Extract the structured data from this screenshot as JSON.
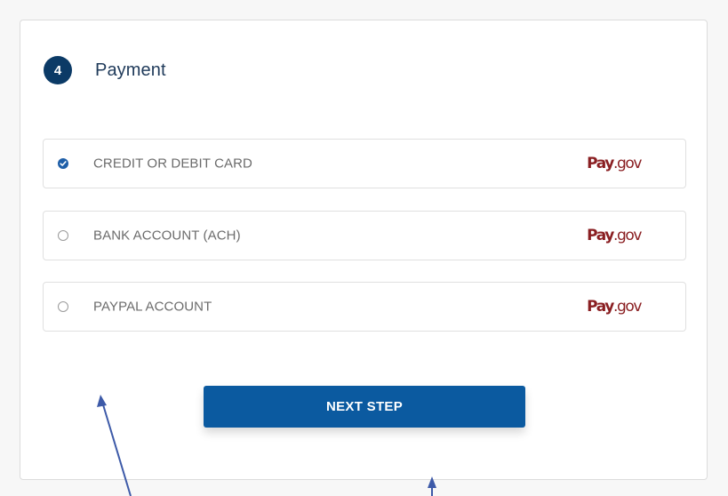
{
  "step": {
    "number": "4",
    "title": "Payment"
  },
  "payment_options": [
    {
      "label": "CREDIT OR DEBIT CARD",
      "selected": true,
      "logo_pay": "Pay",
      "logo_gov": ".gov"
    },
    {
      "label": "BANK ACCOUNT (ACH)",
      "selected": false,
      "logo_pay": "Pay",
      "logo_gov": ".gov"
    },
    {
      "label": "PAYPAL ACCOUNT",
      "selected": false,
      "logo_pay": "Pay",
      "logo_gov": ".gov"
    }
  ],
  "next_button": {
    "label": "NEXT STEP"
  },
  "colors": {
    "badge": "#0b3a66",
    "button": "#0b5aa0",
    "logo": "#8a1f22",
    "annotation_arrow": "#3d5aa8"
  }
}
